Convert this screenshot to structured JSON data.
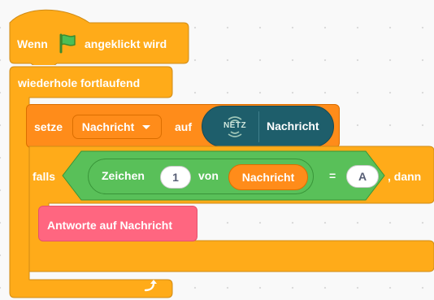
{
  "hat_block": {
    "label_prefix": "Wenn",
    "label_suffix": "angeklickt wird",
    "icon": "green-flag-icon"
  },
  "forever_block": {
    "label": "wiederhole fortlaufend",
    "icon": "loop-arrow-icon"
  },
  "set_block": {
    "label": "setze",
    "variable": "Nachricht",
    "dropdown_icon": "dropdown-triangle-icon",
    "to_label": "auf",
    "netz_icon_text": "NETZ",
    "netz_reporter": "Nachricht"
  },
  "if_block": {
    "label": "falls",
    "suffix": ", dann",
    "letter_label": "Zeichen",
    "index_value": "1",
    "of_label": "von",
    "of_variable": "Nachricht",
    "equals": "=",
    "compare_value": "A"
  },
  "answer_block": {
    "label": "Antworte auf Nachricht"
  },
  "colors": {
    "control": "#ffab19",
    "variable": "#ff8c1a",
    "operator": "#59c059",
    "netz": "#1e5e6b",
    "answer": "#ff6680"
  }
}
